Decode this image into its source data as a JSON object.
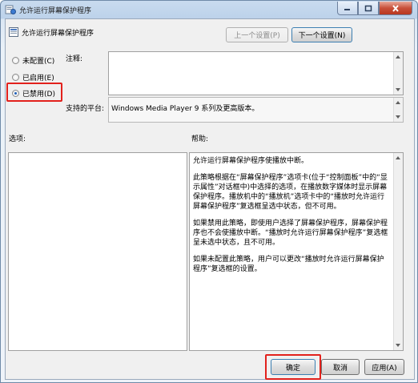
{
  "window": {
    "title": "允许运行屏幕保护程序",
    "heading": "允许运行屏幕保护程序"
  },
  "nav": {
    "prev_label": "上一个设置(P)",
    "next_label": "下一个设置(N)"
  },
  "options": {
    "not_configured": "未配置(C)",
    "enabled": "已启用(E)",
    "disabled": "已禁用(D)",
    "selected": "disabled"
  },
  "comment_label": "注释:",
  "platform": {
    "label": "支持的平台:",
    "value": "Windows Media Player 9 系列及更高版本。"
  },
  "sections": {
    "options_label": "选项:",
    "help_label": "帮助:"
  },
  "help": {
    "p1": "允许运行屏幕保护程序使播放中断。",
    "p2": "此策略根据在“屏幕保护程序”选项卡(位于“控制面板”中的“显示属性”对话框中)中选择的选项，在播放数字媒体时显示屏幕保护程序。播放机中的“播放机”选项卡中的“播放时允许运行屏幕保护程序”复选框呈选中状态，但不可用。",
    "p3": "如果禁用此策略，即使用户选择了屏幕保护程序，屏幕保护程序也不会使播放中断。“播放时允许运行屏幕保护程序”复选框呈未选中状态，且不可用。",
    "p4": "如果未配置此策略，用户可以更改“播放时允许运行屏幕保护程序”复选框的设置。"
  },
  "footer": {
    "ok_label": "确定",
    "cancel_label": "取消",
    "apply_label": "应用(A)"
  },
  "colors": {
    "highlight": "#e2211c",
    "close": "#c8503a"
  }
}
